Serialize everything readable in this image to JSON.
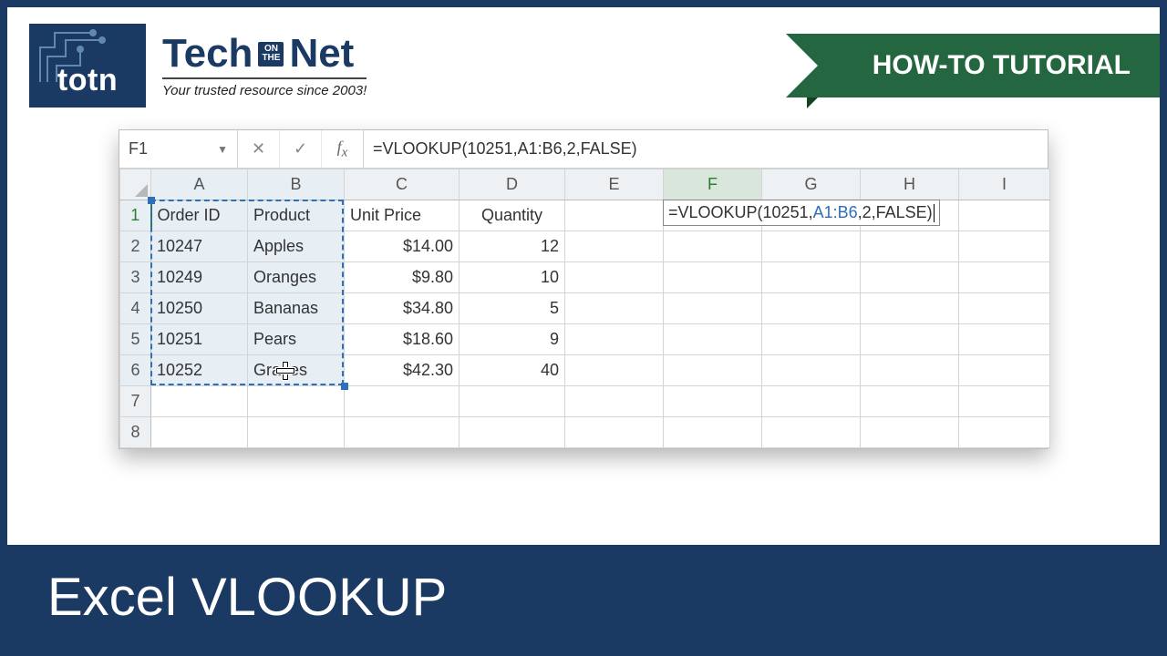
{
  "brand": {
    "logo_text": "totn",
    "word1": "Tech",
    "on": "ON",
    "the": "THE",
    "word2": "Net",
    "tagline": "Your trusted resource since 2003!"
  },
  "ribbon": {
    "label": "HOW-TO TUTORIAL"
  },
  "excel": {
    "active_cell": "F1",
    "formula": "=VLOOKUP(10251,A1:B6,2,FALSE)",
    "columns": [
      "A",
      "B",
      "C",
      "D",
      "E",
      "F",
      "G",
      "H",
      "I"
    ],
    "col_count": 9,
    "active_col_index": 5,
    "row_count": 8,
    "active_row_index": 0,
    "selection": {
      "from": "A1",
      "to": "B6"
    },
    "editing": {
      "pre": "=VLOOKUP(10251,",
      "ref": "A1:B6",
      "post": ",2,FALSE)"
    },
    "headers": [
      "Order ID",
      "Product",
      "Unit Price",
      "Quantity"
    ],
    "rows": [
      {
        "id": "10247",
        "product": "Apples",
        "price": "$14.00",
        "qty": "12"
      },
      {
        "id": "10249",
        "product": "Oranges",
        "price": "$9.80",
        "qty": "10"
      },
      {
        "id": "10250",
        "product": "Bananas",
        "price": "$34.80",
        "qty": "5"
      },
      {
        "id": "10251",
        "product": "Pears",
        "price": "$18.60",
        "qty": "9"
      },
      {
        "id": "10252",
        "product": "Grapes",
        "price": "$42.30",
        "qty": "40"
      }
    ]
  },
  "footer": {
    "title": "Excel VLOOKUP"
  }
}
